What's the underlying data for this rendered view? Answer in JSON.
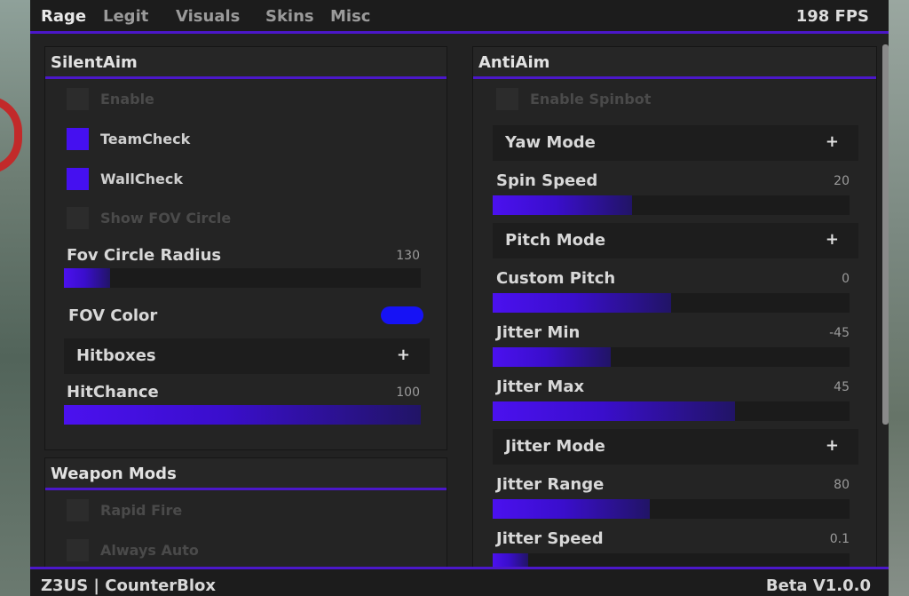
{
  "tabs": [
    "Rage",
    "Legit",
    "Visuals",
    "Skins",
    "Misc"
  ],
  "active_tab": "Rage",
  "fps": "198 FPS",
  "silent_aim": {
    "title": "SilentAim",
    "enable": {
      "label": "Enable",
      "checked": false
    },
    "team_check": {
      "label": "TeamCheck",
      "checked": true
    },
    "wall_check": {
      "label": "WallCheck",
      "checked": true
    },
    "show_fov_circle": {
      "label": "Show FOV Circle",
      "checked": false
    },
    "fov_circle_radius": {
      "label": "Fov Circle Radius",
      "value": "130",
      "fill_fraction": 0.13
    },
    "fov_color": {
      "label": "FOV Color",
      "color": "#1612f5"
    },
    "hitboxes": {
      "label": "Hitboxes",
      "icon": "+"
    },
    "hit_chance": {
      "label": "HitChance",
      "value": "100",
      "fill_fraction": 1.0
    }
  },
  "weapon_mods": {
    "title": "Weapon Mods",
    "rapid_fire": {
      "label": "Rapid Fire",
      "checked": false
    },
    "always_auto": {
      "label": "Always Auto",
      "checked": false
    }
  },
  "anti_aim": {
    "title": "AntiAim",
    "enable_spinbot": {
      "label": "Enable Spinbot",
      "checked": false
    },
    "yaw_mode": {
      "label": "Yaw Mode",
      "icon": "+"
    },
    "spin_speed": {
      "label": "Spin Speed",
      "value": "20",
      "fill_fraction": 0.39
    },
    "pitch_mode": {
      "label": "Pitch Mode",
      "icon": "+"
    },
    "custom_pitch": {
      "label": "Custom Pitch",
      "value": "0",
      "fill_fraction": 0.5
    },
    "jitter_min": {
      "label": "Jitter Min",
      "value": "-45",
      "fill_fraction": 0.33
    },
    "jitter_max": {
      "label": "Jitter Max",
      "value": "45",
      "fill_fraction": 0.68
    },
    "jitter_mode": {
      "label": "Jitter Mode",
      "icon": "+"
    },
    "jitter_range": {
      "label": "Jitter Range",
      "value": "80",
      "fill_fraction": 0.44
    },
    "jitter_speed": {
      "label": "Jitter Speed",
      "value": "0.1",
      "fill_fraction": 0.1
    }
  },
  "footer": {
    "brand": "Z3US | CounterBlox",
    "version": "Beta V1.0.0"
  },
  "accent_color": "#4b17c9"
}
